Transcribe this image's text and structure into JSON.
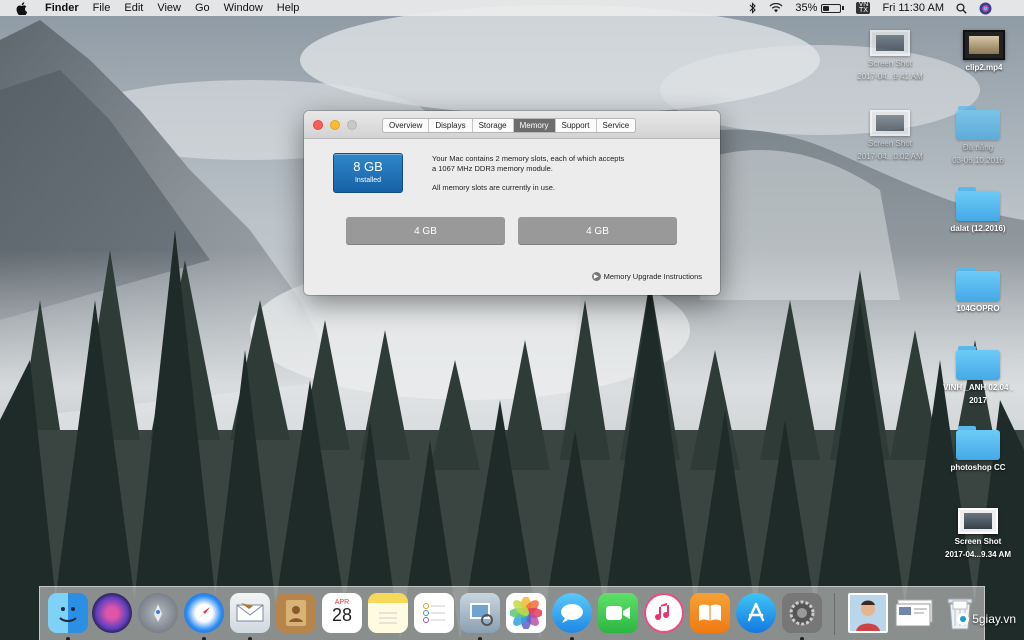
{
  "menubar": {
    "app_name": "Finder",
    "items": [
      "File",
      "Edit",
      "View",
      "Go",
      "Window",
      "Help"
    ],
    "battery_percent": "35%",
    "battery_level": 0.35,
    "input_source": "VN\nTX",
    "clock": "Fri 11:30 AM"
  },
  "about_window": {
    "tabs": [
      "Overview",
      "Displays",
      "Storage",
      "Memory",
      "Support",
      "Service"
    ],
    "active_tab": "Memory",
    "installed_amount": "8 GB",
    "installed_label": "Installed",
    "description_line1": "Your Mac contains 2 memory slots, each of which accepts",
    "description_line2": "a 1067 MHz DDR3 memory module.",
    "description_line3": "All memory slots are currently in use.",
    "slots": [
      "4 GB",
      "4 GB"
    ],
    "upgrade_link": "Memory Upgrade Instructions"
  },
  "desktop_items": [
    {
      "label_1": "Screen Shot",
      "label_2": "2017-04...9.41 AM",
      "kind": "screenshot"
    },
    {
      "label_1": "clip2.mp4",
      "label_2": "",
      "kind": "video"
    },
    {
      "label_1": "Screen Shot",
      "label_2": "2017-04...0.02 AM",
      "kind": "screenshot"
    },
    {
      "label_1": "Đà nẵng",
      "label_2": "03-06.10.2016",
      "kind": "folder"
    },
    {
      "label_1": "dalat (12.2016)",
      "label_2": "",
      "kind": "folder"
    },
    {
      "label_1": "104GOPRO",
      "label_2": "",
      "kind": "folder"
    },
    {
      "label_1": "VINH _ANH 02.04 .",
      "label_2": "2017",
      "kind": "folder"
    },
    {
      "label_1": "photoshop CC",
      "label_2": "",
      "kind": "folder"
    },
    {
      "label_1": "Screen Shot",
      "label_2": "2017-04...9.34 AM",
      "kind": "screenshot"
    }
  ],
  "dock": {
    "apps": [
      "finder-icon",
      "siri-icon",
      "launchpad-icon",
      "safari-icon",
      "mail-icon",
      "contacts-icon",
      "calendar-icon",
      "notes-icon",
      "reminders-icon",
      "preview-icon",
      "photos-icon",
      "messages-icon",
      "facetime-icon",
      "itunes-icon",
      "ibooks-icon",
      "app-store-icon",
      "system-preferences-icon",
      "photo-thumbnail-icon",
      "screenshot-stack-icon",
      "trash-icon"
    ],
    "calendar_month": "APR",
    "calendar_day": "28"
  },
  "watermark": "5giay.vn",
  "colors": {
    "folder_blue": "#5bc0f3",
    "selected_tab": "#6d6d6d",
    "installed_blue": "#1f6fb5"
  }
}
